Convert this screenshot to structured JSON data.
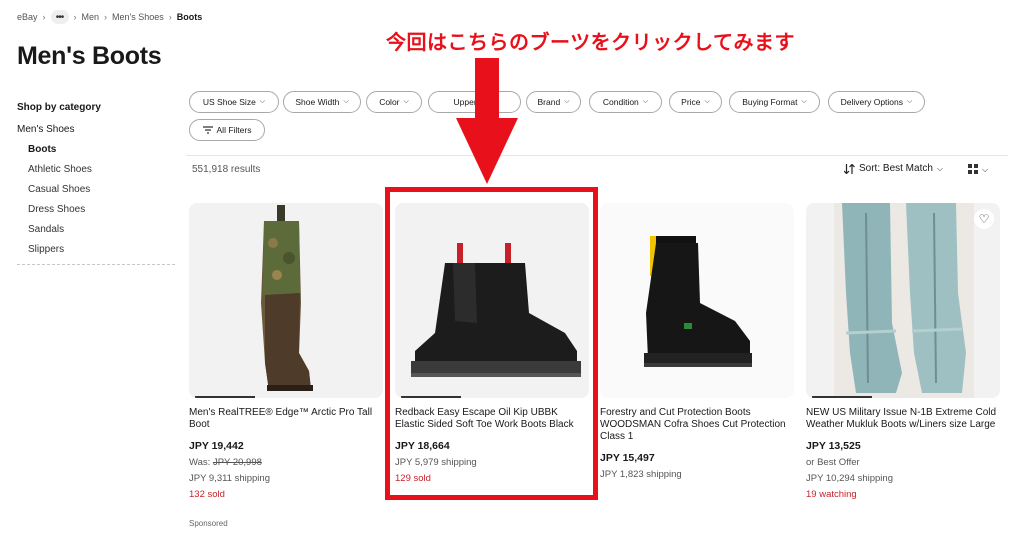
{
  "breadcrumb": {
    "items": [
      "eBay",
      "Men",
      "Men's Shoes"
    ],
    "current": "Boots",
    "more": "•••"
  },
  "page_title": "Men's Boots",
  "sidebar": {
    "heading": "Shop by category",
    "parent": "Men's Shoes",
    "items": [
      "Boots",
      "Athletic Shoes",
      "Casual Shoes",
      "Dress Shoes",
      "Sandals",
      "Slippers"
    ],
    "active": "Boots"
  },
  "filters": [
    "US Shoe Size",
    "Shoe Width",
    "Color",
    "Upper M",
    "Brand",
    "Condition",
    "Price",
    "Buying Format",
    "Delivery Options"
  ],
  "all_filters": "All Filters",
  "results_count": "551,918 results",
  "sort_label": "Sort: Best Match",
  "annotation": "今回はこちらのブーツをクリックしてみます",
  "products": [
    {
      "title": "Men's RealTREE® Edge™ Arctic Pro Tall Boot",
      "price": "JPY 19,442",
      "was_label": "Was:",
      "was_price": "JPY 20,998",
      "shipping": "JPY 9,311 shipping",
      "sold": "132 sold",
      "sponsored": "Sponsored"
    },
    {
      "title": "Redback Easy Escape Oil Kip UBBK Elastic Sided Soft Toe Work Boots Black",
      "price": "JPY 18,664",
      "shipping": "JPY 5,979 shipping",
      "sold": "129 sold"
    },
    {
      "title": "Forestry and Cut Protection Boots WOODSMAN Cofra Shoes Cut Protection Class 1",
      "price": "JPY 15,497",
      "shipping": "JPY 1,823 shipping"
    },
    {
      "title": "NEW US Military Issue N-1B Extreme Cold Weather Mukluk Boots w/Liners size Large",
      "price": "JPY 13,525",
      "offer": "or Best Offer",
      "shipping": "JPY 10,294 shipping",
      "watching": "19 watching"
    }
  ],
  "colors": {
    "accent_red": "#e8101a",
    "sold_red": "#c7232b",
    "text": "#191919",
    "muted": "#555555"
  }
}
